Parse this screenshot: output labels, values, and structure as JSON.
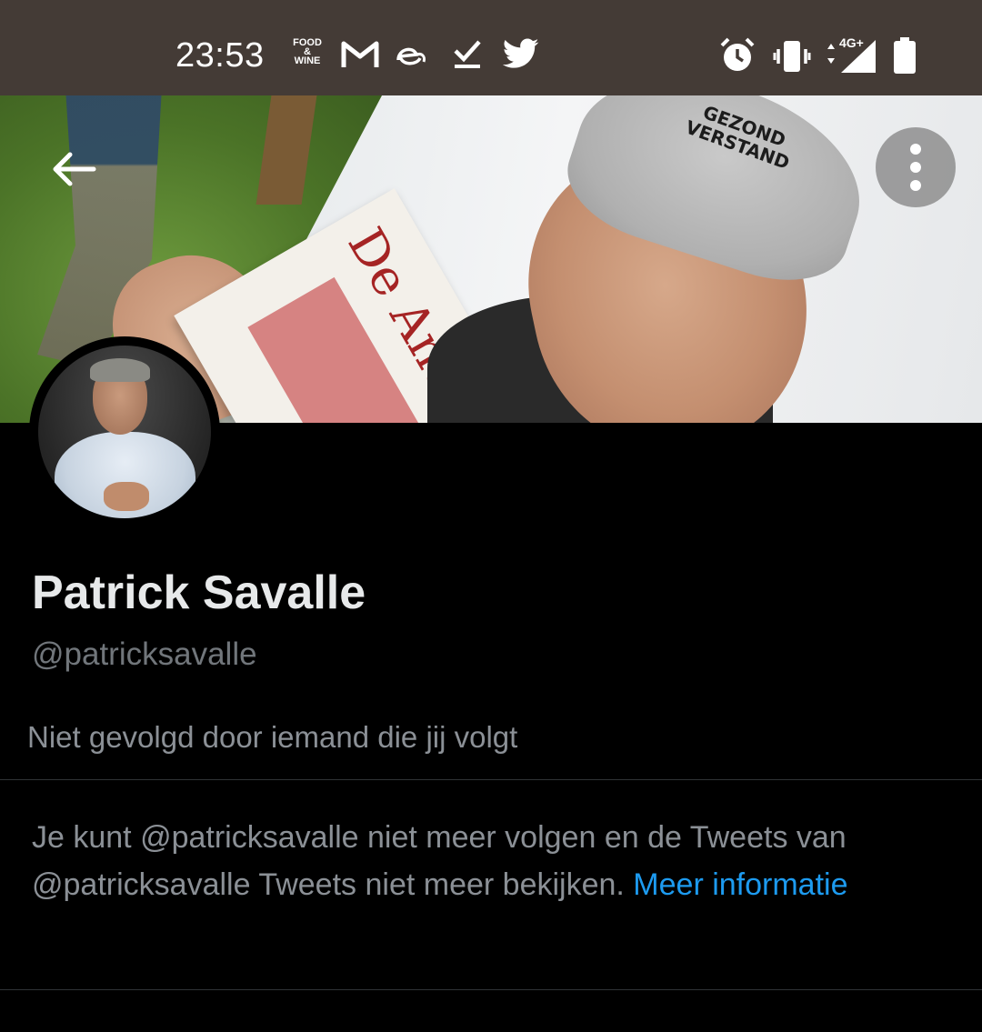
{
  "status_bar": {
    "time": "23:53",
    "notification_icons": [
      "food-wine-icon",
      "gmail-icon",
      "edge-icon",
      "tasks-check-icon",
      "twitter-bird-icon"
    ],
    "food_wine": [
      "FOOD",
      "&",
      "WINE"
    ],
    "network": "4G+",
    "system_icons": [
      "alarm-icon",
      "vibrate-icon",
      "signal-icon",
      "battery-icon"
    ]
  },
  "banner": {
    "newspaper_title": "De Andere",
    "beanie_text": [
      "GEZOND",
      "VERSTAND"
    ]
  },
  "profile": {
    "display_name": "Patrick Savalle",
    "handle": "@patricksavalle",
    "follow_note": "Niet gevolgd door iemand die jij volgt"
  },
  "suspended_notice": {
    "text": "Je kunt @patricksavalle niet meer volgen en de Tweets van @patricksavalle Tweets niet meer bekijken. ",
    "link_label": "Meer informatie"
  },
  "colors": {
    "background": "#000000",
    "status_bar": "#443b36",
    "name": "#e7e9ea",
    "secondary_text": "#71767b",
    "link": "#1d9bf0",
    "divider": "#2f3336"
  }
}
